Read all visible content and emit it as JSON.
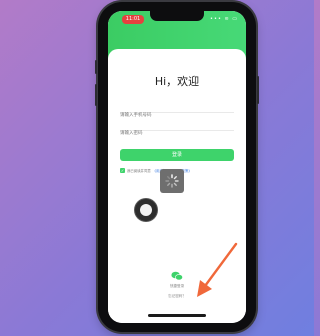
{
  "status_bar": {
    "time": "11:01",
    "icons": "••• ≋ ▭"
  },
  "login": {
    "greeting": "Hi，欢迎",
    "account_placeholder": "请输入手机号码",
    "password_placeholder": "请输入密码",
    "login_button": "登录",
    "agree_text": "我已阅读并同意",
    "agree_link": "《用户协议》《隐私政策》"
  },
  "footer": {
    "quick_login_label": "快捷登录",
    "forgot_password": "忘记密码？"
  },
  "icons": {
    "spinner": "spinner-icon",
    "wechat": "wechat-icon",
    "assistive_touch": "assistive-touch-icon",
    "arrow": "arrow-annotation"
  },
  "colors": {
    "accent_green": "#3ed36b",
    "arrow_orange": "#f0683a",
    "link_blue": "#3a7be0"
  }
}
